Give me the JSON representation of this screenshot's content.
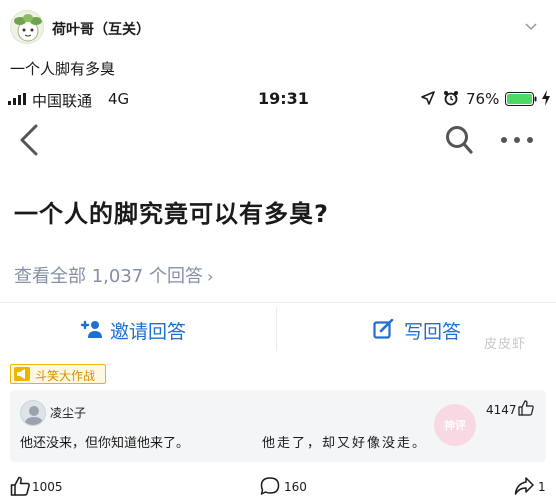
{
  "post": {
    "author": "荷叶哥（互关）",
    "text": "一个人脚有多臭"
  },
  "status_bar": {
    "carrier": "中国联通",
    "network": "4G",
    "time": "19:31",
    "battery_percent": "76%",
    "battery_level": 0.76
  },
  "question": {
    "title": "一个人的脚究竟可以有多臭?",
    "view_all": "查看全部 1,037 个回答",
    "view_all_arrow": "›"
  },
  "actions": {
    "invite": "邀请回答",
    "write": "写回答"
  },
  "watermark": "皮皮虾",
  "badge": {
    "label": "斗笑大作战"
  },
  "comment": {
    "username": "凌尘子",
    "likes": "4147",
    "text_1": "他还没来，但你知道他来了。",
    "text_2": "他走了，却又好像没走。",
    "stamp": "神评"
  },
  "footer": {
    "likes": "1005",
    "comments": "160",
    "shares": "1"
  },
  "colors": {
    "accent": "#1f6fd1",
    "muted": "#8590a6",
    "badge_orange": "#f0b400",
    "battery_green": "#4cd964"
  }
}
